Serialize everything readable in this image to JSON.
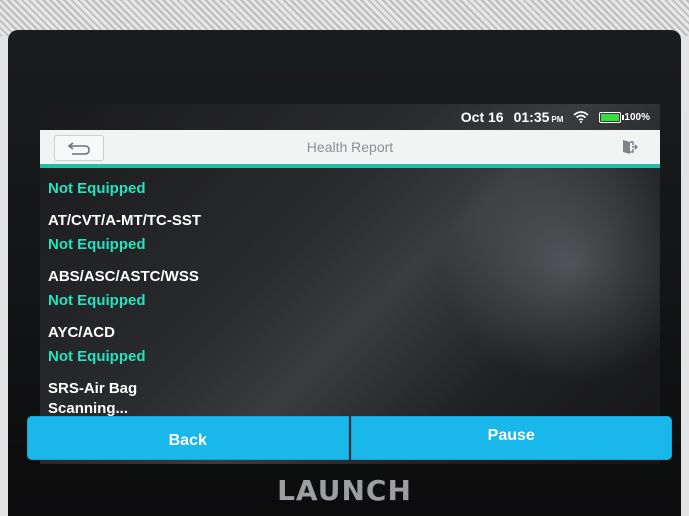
{
  "status_bar": {
    "date": "Oct 16",
    "time": "01:35",
    "ampm": "PM",
    "battery": "100%",
    "battery_level": 1.0,
    "wifi_icon": "wifi-icon"
  },
  "header": {
    "title": "Health Report",
    "back_icon": "back-arrow-icon",
    "exit_icon": "exit-icon"
  },
  "systems": [
    {
      "name": "",
      "status": "Not Equipped"
    },
    {
      "name": "AT/CVT/A-MT/TC-SST",
      "status": "Not Equipped"
    },
    {
      "name": "ABS/ASC/ASTC/WSS",
      "status": "Not Equipped"
    },
    {
      "name": "AYC/ACD",
      "status": "Not Equipped"
    },
    {
      "name": "SRS-Air Bag",
      "status": "Scanning..."
    }
  ],
  "buttons": {
    "back": "Back",
    "pause": "Pause"
  },
  "brand": "LAUNCH",
  "colors": {
    "accent": "#1fc1a2",
    "status_green": "#22e4c0",
    "button_blue": "#19b7ea"
  }
}
